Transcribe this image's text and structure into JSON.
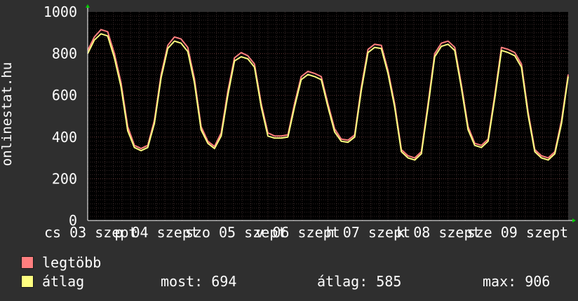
{
  "chart_data": {
    "type": "line",
    "y_axis_label": "onlinestat.hu",
    "y_ticks": [
      "0",
      "200",
      "400",
      "600",
      "800",
      "1000"
    ],
    "ylim": [
      0,
      1000
    ],
    "x_tick_labels": [
      "cs 03 szept",
      "p 04 szept",
      "szo 05 szept",
      "v 06 szept",
      "h 07 szept",
      "k 08 szept",
      "sze 09 szept"
    ],
    "grid": true,
    "series": [
      {
        "name": "legtöbb",
        "color": "#ff7f7f",
        "values": [
          815,
          880,
          915,
          905,
          800,
          660,
          450,
          360,
          345,
          360,
          480,
          700,
          840,
          880,
          870,
          830,
          680,
          450,
          380,
          355,
          420,
          620,
          780,
          805,
          790,
          750,
          560,
          420,
          405,
          405,
          410,
          560,
          690,
          715,
          705,
          690,
          560,
          440,
          390,
          385,
          410,
          640,
          820,
          845,
          840,
          720,
          560,
          340,
          310,
          300,
          330,
          560,
          800,
          850,
          860,
          830,
          650,
          450,
          370,
          360,
          390,
          600,
          830,
          820,
          805,
          750,
          520,
          340,
          310,
          300,
          330,
          480,
          700
        ]
      },
      {
        "name": "átlag",
        "color": "#ffff80",
        "values": [
          800,
          865,
          895,
          885,
          780,
          640,
          430,
          350,
          335,
          350,
          465,
          685,
          825,
          860,
          850,
          810,
          660,
          435,
          370,
          345,
          405,
          600,
          765,
          785,
          775,
          735,
          545,
          405,
          395,
          395,
          400,
          545,
          675,
          700,
          690,
          675,
          545,
          425,
          380,
          375,
          400,
          625,
          805,
          830,
          825,
          705,
          545,
          330,
          300,
          290,
          320,
          545,
          785,
          835,
          845,
          815,
          635,
          435,
          360,
          350,
          380,
          585,
          815,
          805,
          790,
          735,
          505,
          330,
          300,
          290,
          320,
          465,
          690
        ]
      }
    ],
    "legend": [
      {
        "label": "legtöbb",
        "color": "#ff7f7f"
      },
      {
        "label": "átlag",
        "color": "#ffff80"
      }
    ],
    "stats": {
      "most": "most: 694",
      "atlag": "átlag: 585",
      "max": "max: 906"
    }
  }
}
